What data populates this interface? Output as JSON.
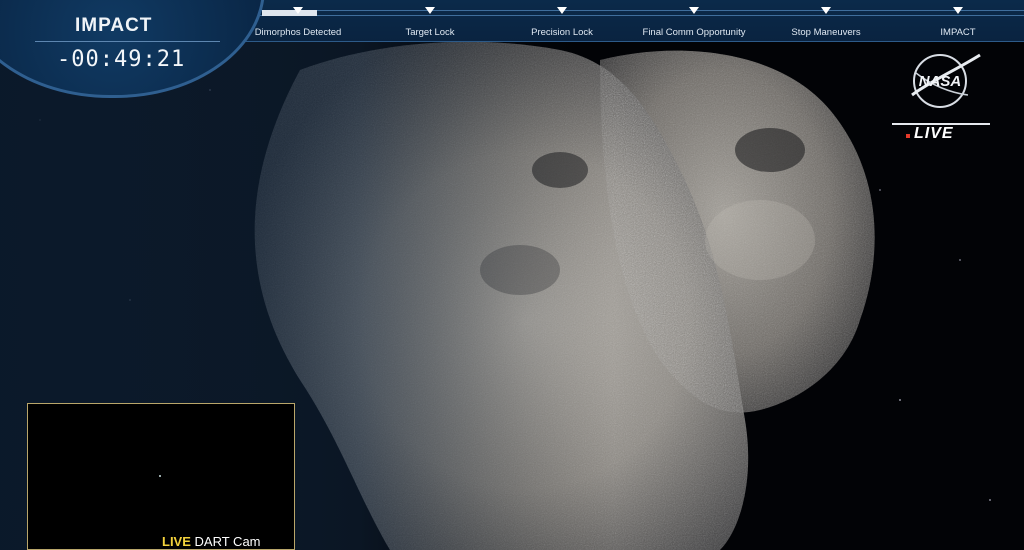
{
  "countdown": {
    "title": "IMPACT",
    "time": "-00:49:21"
  },
  "timeline": {
    "progress_fraction": 0.07,
    "milestones": [
      {
        "label": "Dimorphos Detected"
      },
      {
        "label": "Target Lock"
      },
      {
        "label": "Precision Lock"
      },
      {
        "label": "Final Comm Opportunity"
      },
      {
        "label": "Stop Maneuvers"
      },
      {
        "label": "IMPACT"
      }
    ]
  },
  "broadcast": {
    "logo_text": "NASA",
    "live_label": "LIVE"
  },
  "inset": {
    "live_label": "LIVE",
    "cam_label": "DART Cam"
  },
  "colors": {
    "panel_blue": "#0a2747",
    "inset_live_yellow": "#f4d23c",
    "live_dot_red": "#e53a2a"
  }
}
